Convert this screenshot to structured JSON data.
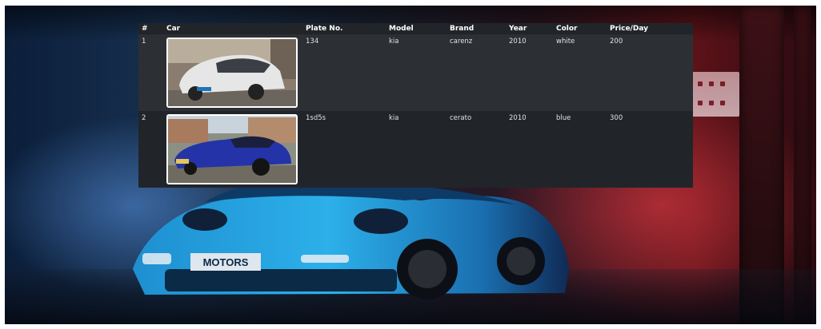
{
  "table": {
    "headers": [
      "#",
      "Car",
      "Plate No.",
      "Model",
      "Brand",
      "Year",
      "Color",
      "Price/Day"
    ],
    "rows": [
      {
        "num": "1",
        "plate": "134",
        "model": "kia",
        "brand": "carenz",
        "year": "2010",
        "color": "white",
        "price": "200"
      },
      {
        "num": "2",
        "plate": "1sd5s",
        "model": "kia",
        "brand": "cerato",
        "year": "2010",
        "color": "blue",
        "price": "300"
      }
    ]
  },
  "background": {
    "plate_text": "MOTORS"
  },
  "colors": {
    "table_bg": "#212529",
    "row_stripe": "#2c3034",
    "hero_car": "#2aa7e0"
  }
}
